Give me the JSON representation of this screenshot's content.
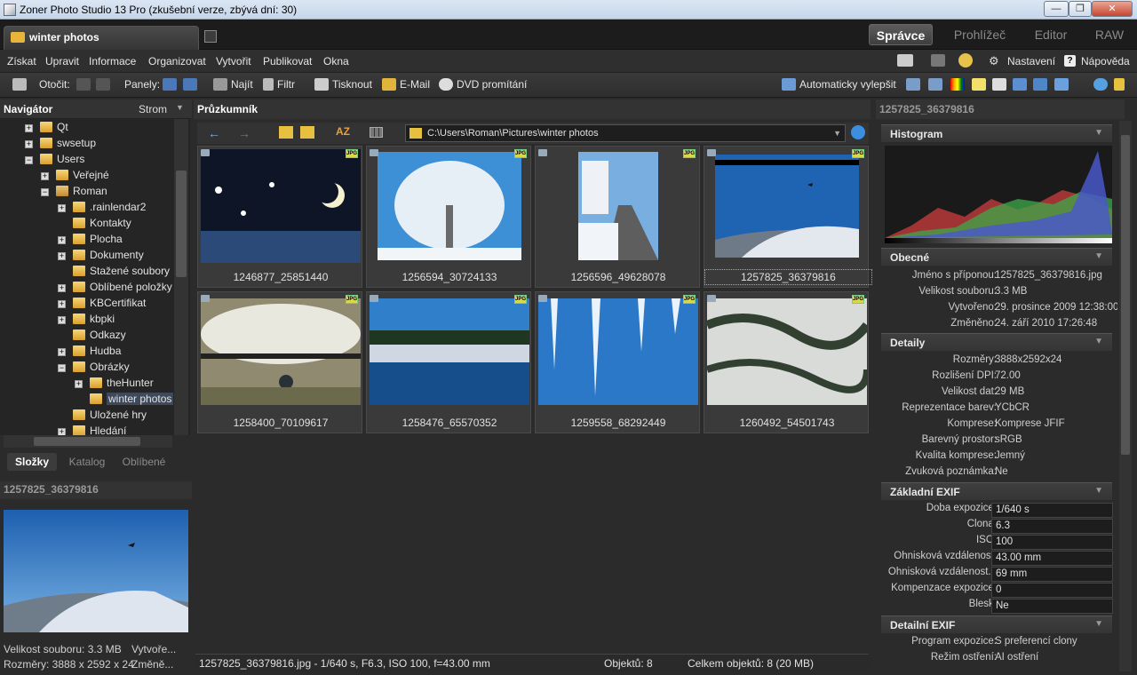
{
  "window": {
    "title": "Zoner Photo Studio 13 Pro (zkušební verze, zbývá dní: 30)",
    "min": "—",
    "max": "❐",
    "close": "✕"
  },
  "tabs": {
    "doc_tab": "winter photos",
    "modes": [
      "Správce",
      "Prohlížeč",
      "Editor",
      "RAW"
    ]
  },
  "menu": [
    "Získat",
    "Upravit",
    "Informace",
    "Organizovat",
    "Vytvořit",
    "Publikovat",
    "Okna"
  ],
  "menu_right": {
    "settings": "Nastavení",
    "help": "Nápověda"
  },
  "toolbar": {
    "rotate": "Otočit:",
    "panels": "Panely:",
    "find": "Najít",
    "filter": "Filtr",
    "print": "Tisknout",
    "email": "E-Mail",
    "dvd": "DVD promítání",
    "auto": "Automaticky vylepšit"
  },
  "navigator": {
    "title": "Navigátor",
    "mode": "Strom"
  },
  "tree": [
    "Qt",
    "swsetup",
    "Users",
    "Veřejné",
    "Roman",
    ".rainlendar2",
    "Kontakty",
    "Plocha",
    "Dokumenty",
    "Stažené soubory",
    "Oblíbené položky",
    "KBCertifikat",
    "kbpki",
    "Odkazy",
    "Hudba",
    "Obrázky",
    "theHunter",
    "winter photos",
    "Uložené hry",
    "Hledání"
  ],
  "left_tabs": [
    "Složky",
    "Katalog",
    "Oblíbené"
  ],
  "preview": {
    "title": "1257825_36379816",
    "size": "Velikost souboru: 3.3 MB",
    "created": "Vytvoře...",
    "dims": "Rozměry: 3888 x 2592 x 24",
    "modified": "Změně..."
  },
  "explorer": {
    "title": "Průzkumník",
    "path": "C:\\Users\\Roman\\Pictures\\winter photos"
  },
  "thumbs": [
    "1246877_25851440",
    "1256594_30724133",
    "1256596_49628078",
    "1257825_36379816",
    "1258400_70109617",
    "1258476_65570352",
    "1259558_68292449",
    "1260492_54501743"
  ],
  "jpg_label": "JPG",
  "status": {
    "file": "1257825_36379816.jpg - 1/640 s, F6.3, ISO 100, f=43.00 mm",
    "objects": "Objektů: 8",
    "total": "Celkem objektů: 8 (20 MB)"
  },
  "right": {
    "title": "1257825_36379816",
    "histogram": "Histogram",
    "general": {
      "title": "Obecné",
      "rows": [
        [
          "Jméno s příponou:",
          "1257825_36379816.jpg"
        ],
        [
          "Velikost souboru:",
          "3.3 MB"
        ],
        [
          "Vytvořeno:",
          "29. prosince 2009 12:38:00"
        ],
        [
          "Změněno:",
          "24. září 2010 17:26:48"
        ]
      ]
    },
    "details": {
      "title": "Detaily",
      "rows": [
        [
          "Rozměry:",
          "3888x2592x24"
        ],
        [
          "Rozlišení DPI:",
          "72.00"
        ],
        [
          "Velikost dat:",
          "29 MB"
        ],
        [
          "Reprezentace barev:",
          "YCbCR"
        ],
        [
          "Komprese:",
          "Komprese JFIF"
        ],
        [
          "Barevný prostor:",
          "sRGB"
        ],
        [
          "Kvalita komprese:",
          "Jemný"
        ],
        [
          "Zvuková poznámka:",
          "Ne"
        ]
      ]
    },
    "exif": {
      "title": "Základní EXIF",
      "rows": [
        [
          "Doba expozice:",
          "1/640 s"
        ],
        [
          "Clona:",
          "6.3"
        ],
        [
          "ISO:",
          "100"
        ],
        [
          "Ohnisková vzdálenost:",
          "43.00 mm"
        ],
        [
          "Ohnisková vzdálenost...",
          "69 mm"
        ],
        [
          "Kompenzace expozice:",
          "0"
        ],
        [
          "Blesk:",
          "Ne"
        ]
      ]
    },
    "dexif": {
      "title": "Detailní EXIF",
      "rows": [
        [
          "Program expozice:",
          "S preferencí clony"
        ],
        [
          "Režim ostření:",
          "AI ostření"
        ]
      ]
    }
  },
  "colors": {
    "bg": "#2b2b2b",
    "panel": "#333333",
    "accent": "#3e4a5c"
  }
}
